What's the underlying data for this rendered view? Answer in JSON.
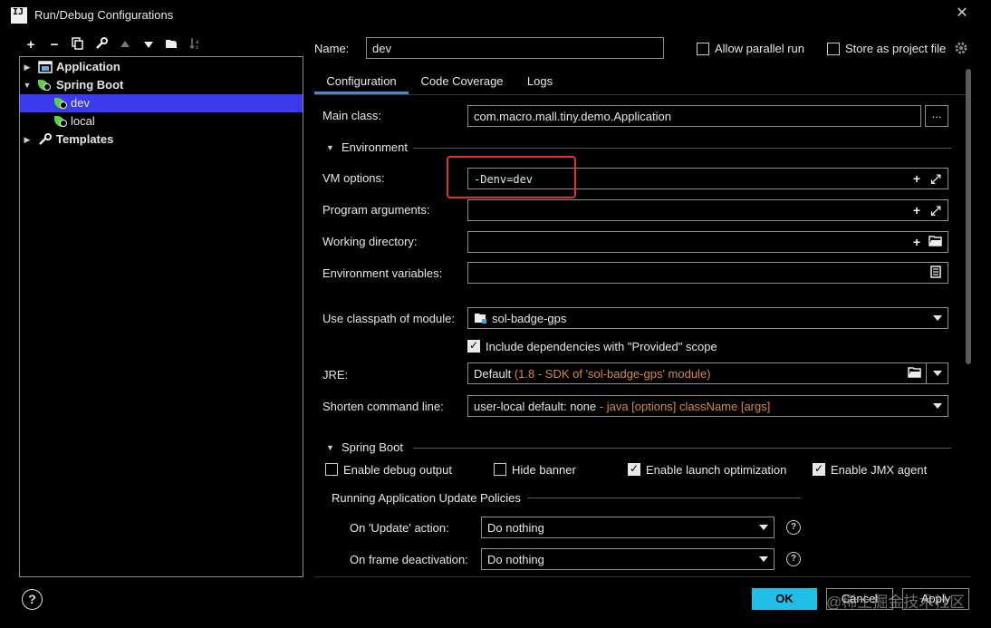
{
  "window": {
    "title": "Run/Debug Configurations",
    "logo_text": "IJ"
  },
  "toolbar": {
    "icons": [
      "add-icon",
      "remove-icon",
      "copy-icon",
      "wrench-icon",
      "move-up-icon",
      "move-down-icon",
      "folder-add-icon",
      "sort-icon"
    ]
  },
  "tree": {
    "items": [
      {
        "label": "Application",
        "bold": true,
        "expanded": false
      },
      {
        "label": "Spring Boot",
        "bold": true,
        "expanded": true
      },
      {
        "label": "dev",
        "selected": true
      },
      {
        "label": "local"
      },
      {
        "label": "Templates",
        "bold": true,
        "expanded": false
      }
    ]
  },
  "header": {
    "name_label": "Name:",
    "name_value": "dev",
    "allow_parallel_label": "Allow parallel run",
    "allow_parallel_checked": false,
    "store_project_label": "Store as project file",
    "store_project_checked": false
  },
  "tabs": [
    {
      "label": "Configuration",
      "active": true
    },
    {
      "label": "Code Coverage",
      "active": false
    },
    {
      "label": "Logs",
      "active": false
    }
  ],
  "config": {
    "main_class_label": "Main class:",
    "main_class_value": "com.macro.mall.tiny.demo.Application",
    "browse_label": "...",
    "environment_section": "Environment",
    "vm_options_label": "VM options:",
    "vm_options_value": "-Denv=dev",
    "program_args_label": "Program arguments:",
    "working_dir_label": "Working directory:",
    "env_vars_label": "Environment variables:",
    "classpath_label": "Use classpath of module:",
    "classpath_value": "sol-badge-gps",
    "include_deps_label": "Include dependencies with \"Provided\" scope",
    "include_deps_checked": true,
    "jre_label": "JRE:",
    "jre_value_main": "Default",
    "jre_value_hint": "(1.8 - SDK of 'sol-badge-gps' module)",
    "shorten_label": "Shorten command line:",
    "shorten_value_main": "user-local default: none",
    "shorten_value_hint": "- java [options] className [args]"
  },
  "spring_boot": {
    "section": "Spring Boot",
    "options": [
      {
        "label": "Enable debug output",
        "checked": false
      },
      {
        "label": "Hide banner",
        "checked": false
      },
      {
        "label": "Enable launch optimization",
        "checked": true
      },
      {
        "label": "Enable JMX agent",
        "checked": true
      }
    ],
    "policies_title": "Running Application Update Policies",
    "update_action_label": "On 'Update' action:",
    "update_action_value": "Do nothing",
    "frame_deactivation_label": "On frame deactivation:",
    "frame_deactivation_value": "Do nothing"
  },
  "buttons": {
    "ok": "OK",
    "cancel": "Cancel",
    "apply": "Apply"
  },
  "watermark": "@稀土掘金技术社区",
  "colors": {
    "selection": "#3a3bea",
    "ok_button": "#1fbfe8",
    "highlight_box": "#e0302c",
    "hint_text": "#d58a3c",
    "spring_leaf": "#5fd04a"
  }
}
